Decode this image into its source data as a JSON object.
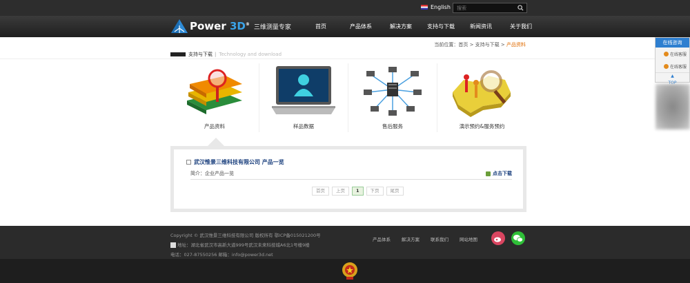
{
  "topbar": {
    "language": "English",
    "search_placeholder": "搜索"
  },
  "header": {
    "brand_a": "Power ",
    "brand_b": "3D",
    "brand_sup": "®",
    "slogan": "三维测量专家",
    "nav": [
      "首页",
      "产品体系",
      "解决方案",
      "支持与下载",
      "新闻资讯",
      "关于我们"
    ]
  },
  "breadcrumb": {
    "prefix": "当前位置：首页 > 支持与下载 > ",
    "current": "产品资料"
  },
  "section": {
    "title": "支持与下载",
    "subtitle": "Technology and download"
  },
  "categories": [
    {
      "label": "产品资料",
      "icon": "books-icon"
    },
    {
      "label": "样品数据",
      "icon": "monitor-user-icon"
    },
    {
      "label": "售后服务",
      "icon": "network-icon"
    },
    {
      "label": "演示预约&服务预约",
      "icon": "map-magnifier-icon"
    }
  ],
  "list": {
    "title": "武汉惟景三维科技有限公司 产品一览",
    "item_text": "简介：企业产品一览",
    "download_label": "点击下载",
    "pager": [
      "首页",
      "上页",
      "1",
      "下页",
      "尾页"
    ]
  },
  "footer": {
    "copyright": "Copyright © 武汉惟景三维科技有限公司 版权所有 鄂ICP备015021200号",
    "address": "地址：湖北省武汉市高新大道999号武汉未来科技城A6北1号楼9楼",
    "contact": "电话：027-87550256  邮箱：info@power3d.net",
    "links": [
      "产品体系",
      "解决方案",
      "联系我们",
      "网站地图"
    ]
  },
  "side": {
    "title": "在线咨询",
    "qq1": "在线客服",
    "qq2": "在线客服",
    "top": "TOP"
  },
  "colors": {
    "accent": "#2e7fd0",
    "brand_blue": "#3aa3e8",
    "link": "#1a3f7d",
    "current": "#e06b00"
  }
}
